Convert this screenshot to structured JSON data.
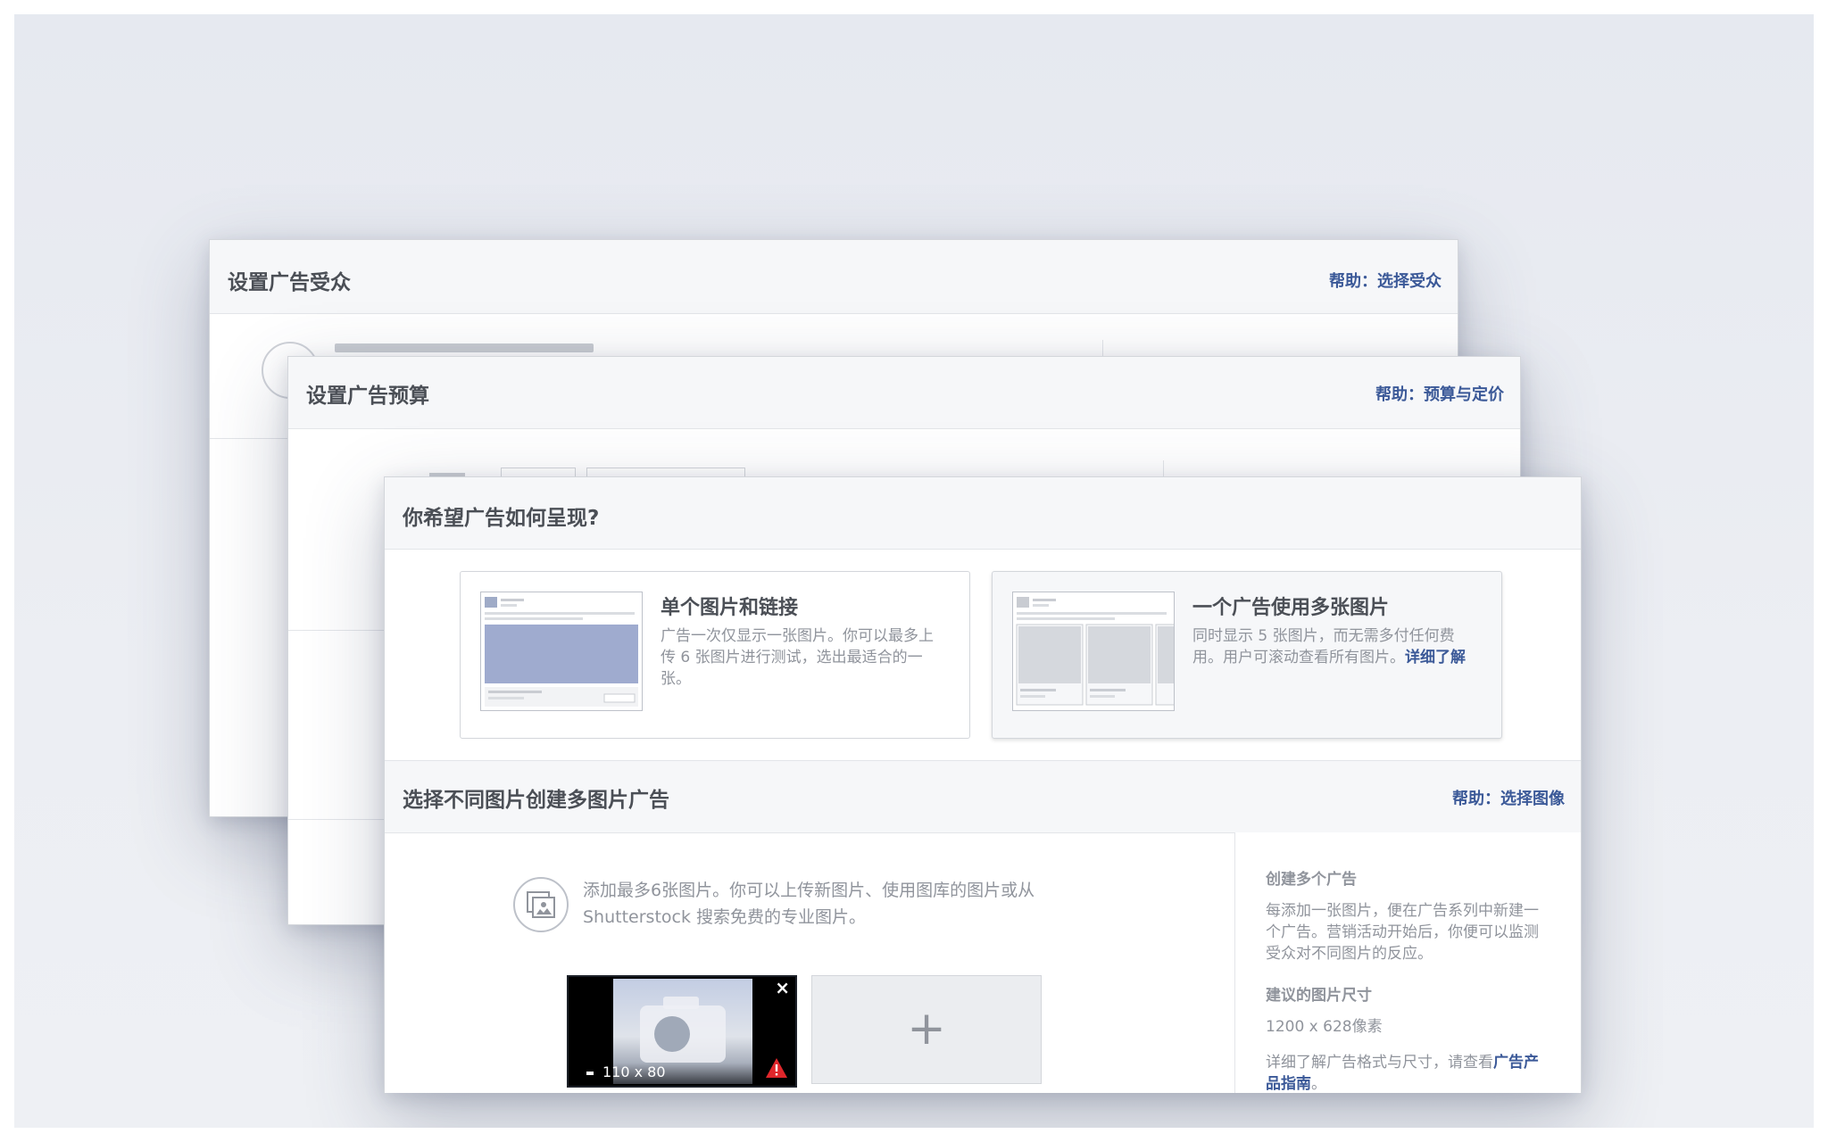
{
  "panel_audience": {
    "title": "设置广告受众",
    "help_prefix": "帮助：",
    "help_link": "选择受众"
  },
  "panel_budget": {
    "title": "设置广告预算",
    "help_prefix": "帮助：",
    "help_link": "预算与定价"
  },
  "panel_format": {
    "title": "你希望广告如何呈现?",
    "options": [
      {
        "title": "单个图片和链接",
        "description": "广告一次仅显示一张图片。你可以最多上传 6 张图片进行测试，选出最适合的一张。"
      },
      {
        "title": "一个广告使用多张图片",
        "description": "同时显示 5 张图片，而无需多付任何费用。用户可滚动查看所有图片。",
        "link": "详细了解"
      }
    ],
    "section2": {
      "title": "选择不同图片创建多图片广告",
      "help_prefix": "帮助：",
      "help_link": "选择图像",
      "add_text": "添加最多6张图片。你可以上传新图片、使用图库的图片或从 Shutterstock 搜索免费的专业图片。",
      "image_size_label": "110 x 80",
      "close_symbol": "×",
      "add_symbol": "+"
    },
    "sidebar": {
      "heading1": "创建多个广告",
      "text1": "每添加一张图片，便在广告系列中新建一个广告。营销活动开始后，你便可以监测受众对不同图片的反应。",
      "heading2": "建议的图片尺寸",
      "text2": "1200 x 628像素",
      "text3": "详细了解广告格式与尺寸，请查看",
      "text3_link": "广告产品指南",
      "text3_end": "。"
    }
  },
  "colors": {
    "link": "#3b5998",
    "header_bg": "#f6f7f9",
    "muted_text": "#90949c",
    "warning": "#e0262b"
  }
}
